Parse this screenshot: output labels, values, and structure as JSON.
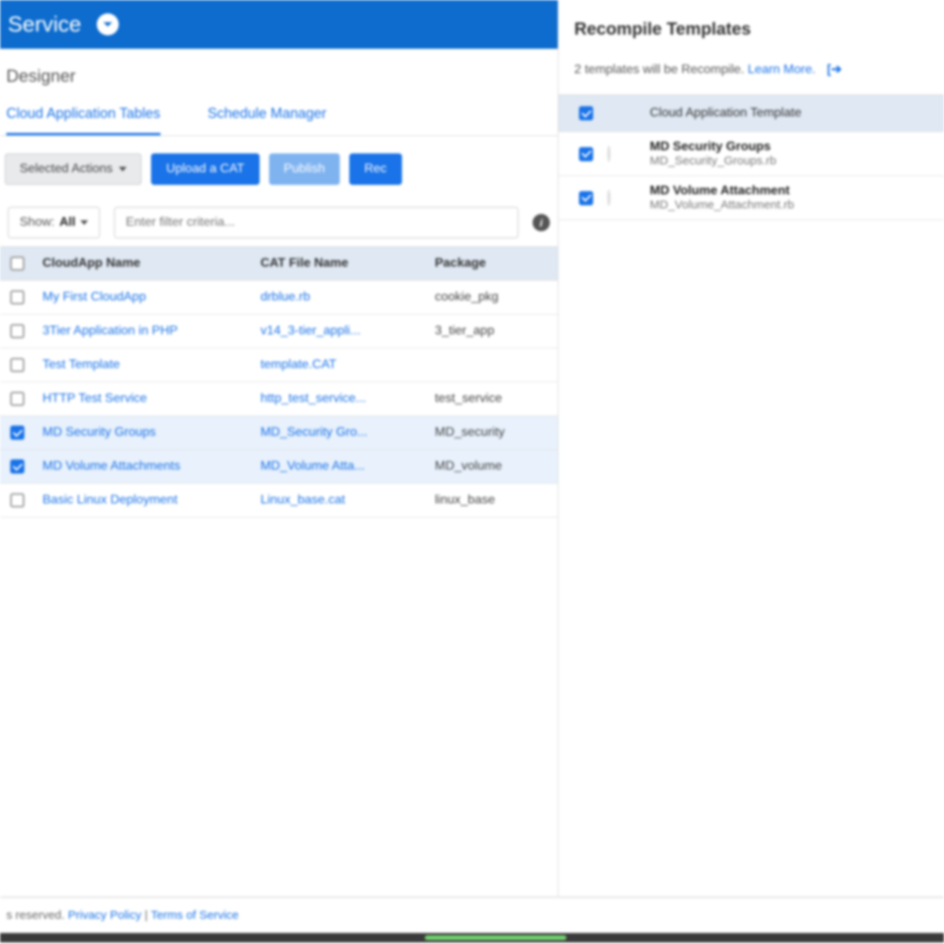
{
  "header": {
    "title": "Service"
  },
  "subtitle": "Designer",
  "tabs": [
    {
      "label": "Cloud Application Tables",
      "active": true
    },
    {
      "label": "Schedule Manager",
      "active": false
    }
  ],
  "toolbar": {
    "selected_actions": "Selected Actions",
    "upload": "Upload a CAT",
    "publish": "Publish",
    "recompile": "Rec"
  },
  "filter": {
    "show_label": "Show:",
    "show_value": "All",
    "placeholder": "Enter filter criteria..."
  },
  "columns": {
    "name": "CloudApp Name",
    "file": "CAT File Name",
    "package": "Package"
  },
  "rows": [
    {
      "checked": false,
      "name": "My First CloudApp",
      "file": "drblue.rb",
      "package": "cookie_pkg",
      "selected": false
    },
    {
      "checked": false,
      "name": "3Tier Application in PHP",
      "file": "v14_3-tier_appli...",
      "package": "3_tier_app",
      "selected": false
    },
    {
      "checked": false,
      "name": "Test Template",
      "file": "template.CAT",
      "package": "",
      "selected": false
    },
    {
      "checked": false,
      "name": "HTTP Test Service",
      "file": "http_test_service...",
      "package": "test_service",
      "selected": false
    },
    {
      "checked": true,
      "name": "MD Security Groups",
      "file": "MD_Security Gro...",
      "package": "MD_security",
      "selected": true
    },
    {
      "checked": true,
      "name": "MD Volume Attachments",
      "file": "MD_Volume Atta...",
      "package": "MD_volume",
      "selected": true
    },
    {
      "checked": false,
      "name": "Basic Linux Deployment",
      "file": "Linux_base.cat",
      "package": "linux_base",
      "selected": false
    }
  ],
  "panel": {
    "title": "Recompile Templates",
    "message_prefix": "2 templates will be Recompile. ",
    "learn_more": "Learn More.",
    "header_label": "Cloud Application Template",
    "items": [
      {
        "checked": true,
        "title": "MD Security Groups",
        "sub": "MD_Security_Groups.rb"
      },
      {
        "checked": true,
        "title": "MD Volume Attachment",
        "sub": "MD_Volume_Attachment.rb"
      }
    ]
  },
  "footer": {
    "reserved": "s reserved. ",
    "privacy": "Privacy Policy",
    "sep": " | ",
    "tos": "Terms of Service"
  }
}
